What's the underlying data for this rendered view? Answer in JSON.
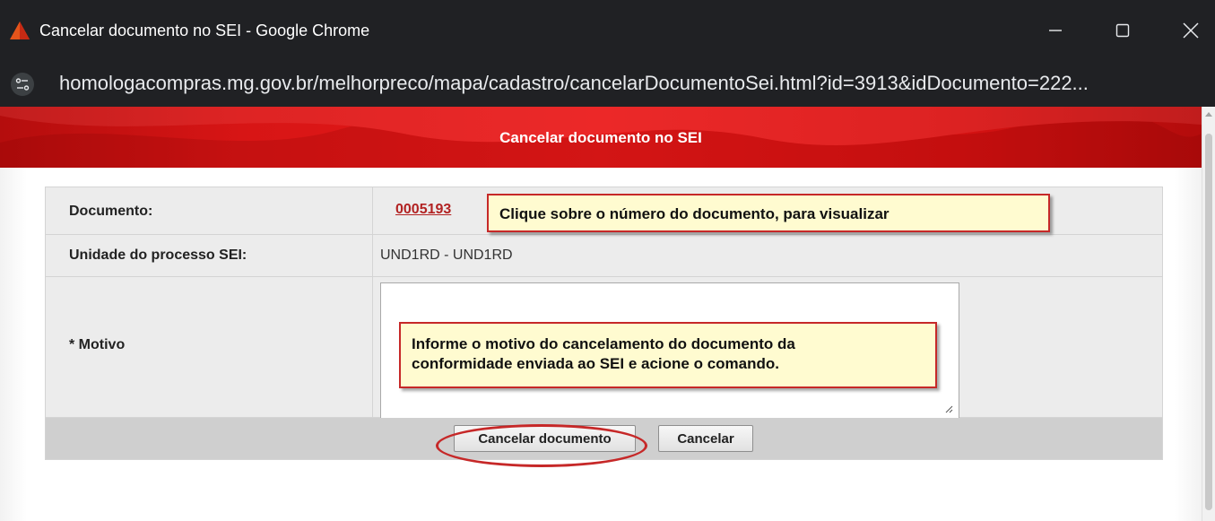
{
  "window": {
    "title": "Cancelar documento no SEI - Google Chrome",
    "app_icon": "red-triangle-icon",
    "controls": [
      "minimize-icon",
      "maximize-icon",
      "close-icon"
    ]
  },
  "address_bar": {
    "site_icon": "site-settings-icon",
    "url": "homologacompras.mg.gov.br/melhorpreco/mapa/cadastro/cancelarDocumentoSei.html?id=3913&idDocumento=222..."
  },
  "page": {
    "title": "Cancelar documento no SEI"
  },
  "form": {
    "documento": {
      "label": "Documento:",
      "value": "0005193"
    },
    "unidade": {
      "label": "Unidade do processo SEI:",
      "value": "UND1RD - UND1RD"
    },
    "motivo": {
      "label": "* Motivo",
      "value": ""
    }
  },
  "buttons": {
    "cancel_document": "Cancelar documento",
    "cancel": "Cancelar"
  },
  "callouts": {
    "document_hint": "Clique sobre o número do documento, para visualizar",
    "motivo_hint_line1": "Informe o motivo do cancelamento do documento da",
    "motivo_hint_line2": "conformidade enviada ao SEI e acione o comando."
  },
  "colors": {
    "header_red": "#e81a1a",
    "callout_border": "#c62828",
    "callout_fill": "#fffbd0",
    "link": "#b22222",
    "titlebar": "#202124"
  }
}
